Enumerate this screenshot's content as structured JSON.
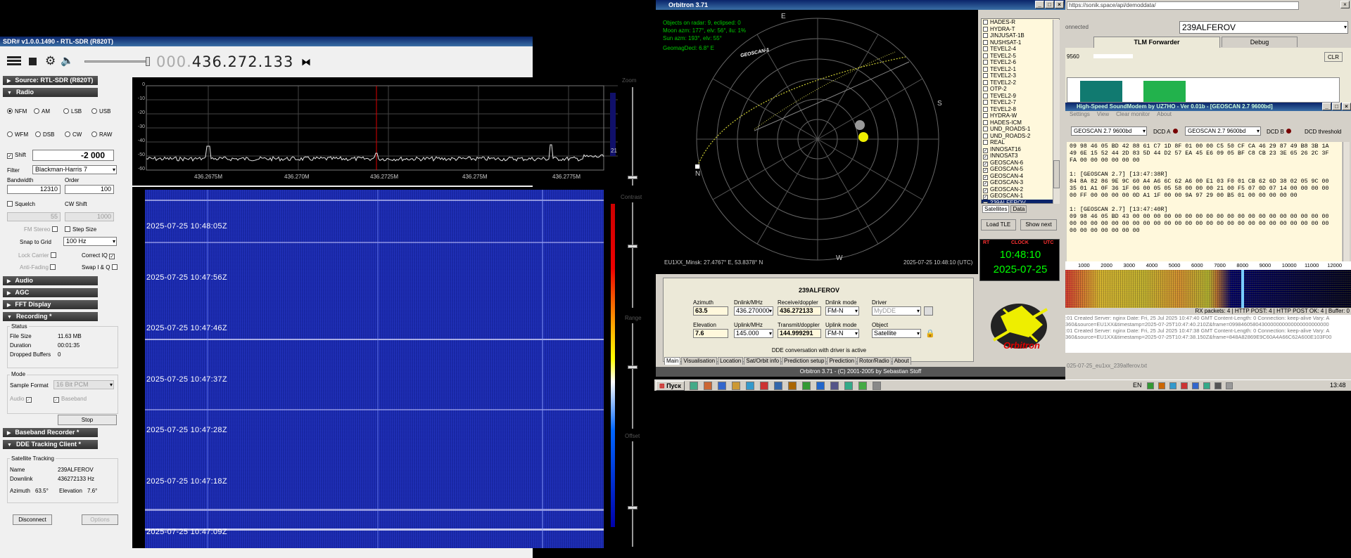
{
  "sdr": {
    "title": "SDR# v1.0.0.1490 - RTL-SDR (R820T)",
    "freq_dim": "000.",
    "freq": "436.272.133",
    "sections": {
      "source": "Source: RTL-SDR (R820T)",
      "radio": "Radio",
      "audio": "Audio",
      "agc": "AGC",
      "fft": "FFT Display",
      "recording": "Recording *",
      "baseband": "Baseband Recorder *",
      "dde": "DDE Tracking Client *"
    },
    "modes": [
      "NFM",
      "AM",
      "LSB",
      "USB",
      "WFM",
      "DSB",
      "CW",
      "RAW"
    ],
    "selected_mode": "NFM",
    "shift_label": "Shift",
    "shift_value": "-2 000",
    "filter_label": "Filter",
    "filter_value": "Blackman-Harris 7",
    "bandwidth_label": "Bandwidth",
    "bandwidth_value": "12310",
    "order_label": "Order",
    "order_value": "100",
    "squelch_label": "Squelch",
    "cwshift_label": "CW Shift",
    "squelch_value": "55",
    "cwshift_value": "1000",
    "fm_stereo": "FM Stereo",
    "step_size": "Step Size",
    "snap_label": "Snap to Grid",
    "snap_value": "100 Hz",
    "lock_carrier": "Lock Carrier",
    "correct_iq": "Correct IQ",
    "anti_fading": "Anti-Fading",
    "swap_iq": "Swap I & Q",
    "status": {
      "title": "Status",
      "file_size_label": "File Size",
      "file_size": "11.63 MB",
      "duration_label": "Duration",
      "duration": "00:01:35",
      "dropped_label": "Dropped Buffers",
      "dropped": "0"
    },
    "mode": {
      "title": "Mode",
      "format_label": "Sample Format",
      "format_value": "16 Bit PCM",
      "audio": "Audio",
      "baseband": "Baseband",
      "stop": "Stop"
    },
    "tracking": {
      "title": "Satellite Tracking",
      "name_label": "Name",
      "name": "239ALFEROV",
      "downlink_label": "Downlink",
      "downlink": "436272133 Hz",
      "azimuth_label": "Azimuth",
      "azimuth": "63.5°",
      "elevation_label": "Elevation",
      "elevation": "7.6°",
      "disconnect": "Disconnect",
      "options": "Options"
    },
    "fft_y_ticks": [
      "0",
      "-10",
      "-20",
      "-30",
      "-40",
      "-50",
      "-60"
    ],
    "fft_x_ticks": [
      "436.2675M",
      "436.270M",
      "436.2725M",
      "436.275M",
      "436.2775M"
    ],
    "fft_side_value": "21",
    "waterfall_times": [
      "2025-07-25 10:48:05Z",
      "2025-07-25 10:47:56Z",
      "2025-07-25 10:47:46Z",
      "2025-07-25 10:47:37Z",
      "2025-07-25 10:47:28Z",
      "2025-07-25 10:47:18Z",
      "2025-07-25 10:47:09Z"
    ],
    "right_labels": {
      "zoom": "Zoom",
      "contrast": "Contrast",
      "range": "Range",
      "offset": "Offset"
    }
  },
  "orbitron": {
    "title": "Orbitron 3.71",
    "info": [
      "Objects on radar: 9, eclipsed: 0",
      "Moon azm: 177°, elv: 56°, ilu: 1%",
      "Sun azm: 193°, elv: 55°",
      "GeomagDecl: 6.8° E"
    ],
    "radar_sat_label": "GEOSCAN-1",
    "directions": {
      "n": "N",
      "e": "E",
      "s": "S",
      "w": "W"
    },
    "location": "EU1XX_Minsk: 27.4767° E, 53.8378° N",
    "datetime_utc": "2025-07-25 10:48:10 (UTC)",
    "satellites": [
      {
        "name": "HADES-R",
        "checked": false
      },
      {
        "name": "HYDRA-T",
        "checked": false
      },
      {
        "name": "JINJUSAT-1B",
        "checked": false
      },
      {
        "name": "NUSHSAT-1",
        "checked": false
      },
      {
        "name": "TEVEL2-4",
        "checked": false
      },
      {
        "name": "TEVEL2-5",
        "checked": false
      },
      {
        "name": "TEVEL2-6",
        "checked": false
      },
      {
        "name": "TEVEL2-1",
        "checked": false
      },
      {
        "name": "TEVEL2-3",
        "checked": false
      },
      {
        "name": "TEVEL2-2",
        "checked": false
      },
      {
        "name": "OTP-2",
        "checked": false
      },
      {
        "name": "TEVEL2-9",
        "checked": false
      },
      {
        "name": "TEVEL2-7",
        "checked": false
      },
      {
        "name": "TEVEL2-8",
        "checked": false
      },
      {
        "name": "HYDRA-W",
        "checked": false
      },
      {
        "name": "HADES-ICM",
        "checked": false
      },
      {
        "name": "UND_ROADS-1",
        "checked": false
      },
      {
        "name": "UND_ROADS-2",
        "checked": false
      },
      {
        "name": "REAL",
        "checked": false
      },
      {
        "name": "INNOSAT16",
        "checked": true
      },
      {
        "name": "INNOSAT3",
        "checked": true
      },
      {
        "name": "GEOSCAN-6",
        "checked": true
      },
      {
        "name": "GEOSCAN-5",
        "checked": true
      },
      {
        "name": "GEOSCAN-4",
        "checked": true
      },
      {
        "name": "GEOSCAN-3",
        "checked": true
      },
      {
        "name": "GEOSCAN-2",
        "checked": true
      },
      {
        "name": "GEOSCAN-1",
        "checked": true
      },
      {
        "name": "239ALFEROV",
        "checked": true,
        "selected": true
      }
    ],
    "list_tabs": [
      "Satellites",
      "Data"
    ],
    "load_tle": "Load TLE",
    "show_next": "Show next",
    "clock_tabs": [
      "RT",
      "CLOCK",
      "UTC"
    ],
    "time": "10:48:10",
    "date": "2025-07-25",
    "panel": {
      "sat_name": "239ALFEROV",
      "azimuth_label": "Azimuth",
      "azimuth": "63.5",
      "dnlink_label": "Dnlink/MHz",
      "dnlink": "436.270000",
      "rx_doppler_label": "Receive/doppler",
      "rx_doppler": "436.272133",
      "dnlink_mode_label": "Dnlink mode",
      "dnlink_mode": "FM-N",
      "driver_label": "Driver",
      "driver": "MyDDE",
      "elevation_label": "Elevation",
      "elevation": "7.6",
      "uplink_label": "Uplink/MHz",
      "uplink": "145.000",
      "tx_doppler_label": "Transmit/doppler",
      "tx_doppler": "144.999291",
      "uplink_mode_label": "Uplink mode",
      "uplink_mode": "FM-N",
      "object_label": "Object",
      "object": "Satellite",
      "status": "DDE conversation with driver is active"
    },
    "tabs": [
      "Main",
      "Visualisation",
      "Location",
      "Sat/Orbit info",
      "Prediction setup",
      "Prediction",
      "Rotor/Radio",
      "About"
    ],
    "footer": "Orbitron 3.71 - (C) 2001-2005 by Sebastian Stoff",
    "logo": "Orbitron"
  },
  "forwarder": {
    "url": "https://sonik.space/api/demoddata/",
    "connected": "onnected",
    "combo": "239ALFEROV",
    "tab_tlm": "TLM Forwarder",
    "tab_debug": "Debug",
    "field": "9560",
    "clr": "CLR"
  },
  "soundmodem": {
    "title": "High-Speed SoundModem by UZ7HO - Ver 0.01b - [GEOSCAN 2.7 9600bd]",
    "menu": [
      "Settings",
      "View",
      "Clear monitor",
      "About"
    ],
    "mode_a": "GEOSCAN 2.7 9600bd",
    "dcd_a": "DCD A",
    "mode_b": "GEOSCAN 2.7 9600bd",
    "dcd_b": "DCD B",
    "dcd_threshold": "DCD threshold",
    "hex_lines": [
      "09 98 46 05 BD 42 88 61 C7 1D 8F 01 00 00 C5 50 CF CA 46 29 87 49 B8 3B 1A",
      "49 6E 15 52 44 2D 83 5D 44 D2 57 EA 45 E6 09 05 BF C8 CB 23 3E 65 26 2C 3F",
      "FA 00 00 00 00 00 00",
      "",
      "1: [GEOSCAN 2.7] [13:47:38R]",
      "84 8A 82 86 9E 9C 60 A4 A6 6C 62 A6 00 E1 03 F0 01 CB 62 6D 38 02 05 9C 00",
      "35 01 A1 0F 36 1F 06 00 05 05 58 00 00 00 21 00 F5 07 0D 07 14 00 00 00 00",
      "00 FF 00 00 00 00 0D A1 1F 00 00 9A 97 29 00 B5 01 00 00 00 00 00",
      "",
      "1: [GEOSCAN 2.7] [13:47:40R]",
      "09 98 46 05 BD 43 00 00 00 00 00 00 00 00 00 00 00 00 00 00 00 00 00 00 00",
      "00 00 00 00 00 00 00 00 00 00 00 00 00 00 00 00 00 00 00 00 00 00 00 00 00",
      "00 00 00 00 00 00 00"
    ],
    "scale": [
      "1000",
      "2000",
      "3000",
      "4000",
      "5000",
      "6000",
      "7000",
      "8000",
      "9000",
      "10000",
      "11000",
      "12000"
    ],
    "stats": "RX packets: 4 | HTTP POST: 4 | HTTP POST OK: 4 | Buffer: 0",
    "log": [
      ":01 Created Server: nginx Date: Fri, 25 Jul 2025 10:47:40 GMT Content-Length: 0 Connection: keep-alive Vary: A",
      "360&source=EU1XX&timestamp=2025-07-25T10:47:40.210Z&frame=0998460580430000000000000000000000",
      ":01 Created Server: nginx Date: Fri, 25 Jul 2025 10:47:38 GMT Content-Length: 0 Connection: keep-alive Vary: A",
      "360&source=EU1XX&timestamp=2025-07-25T10:47:38.150Z&frame=848A82869E9C60A4A66C62A600E103F00"
    ],
    "logfile": "025-07-25_eu1xx_239alferov.txt"
  },
  "taskbar": {
    "start": "Пуск",
    "lang": "EN",
    "clock": "13:48"
  }
}
